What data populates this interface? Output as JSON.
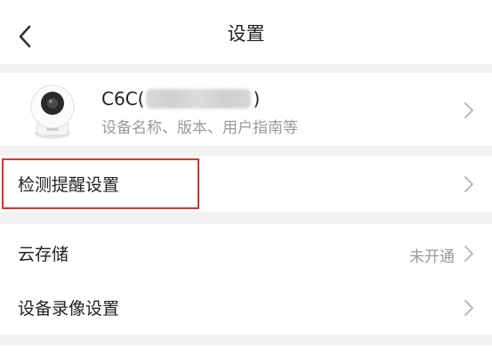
{
  "header": {
    "title": "设置",
    "back_icon": "chevron-left-icon"
  },
  "device": {
    "name_prefix": "C6C(",
    "name_suffix": ")",
    "subtitle": "设备名称、版本、用户指南等"
  },
  "menu": {
    "detection": {
      "label": "检测提醒设置"
    },
    "cloud_storage": {
      "label": "云存储",
      "value": "未开通"
    },
    "recording": {
      "label": "设备录像设置"
    }
  },
  "colors": {
    "highlight": "#d9342b",
    "background": "#f2f2f2"
  }
}
